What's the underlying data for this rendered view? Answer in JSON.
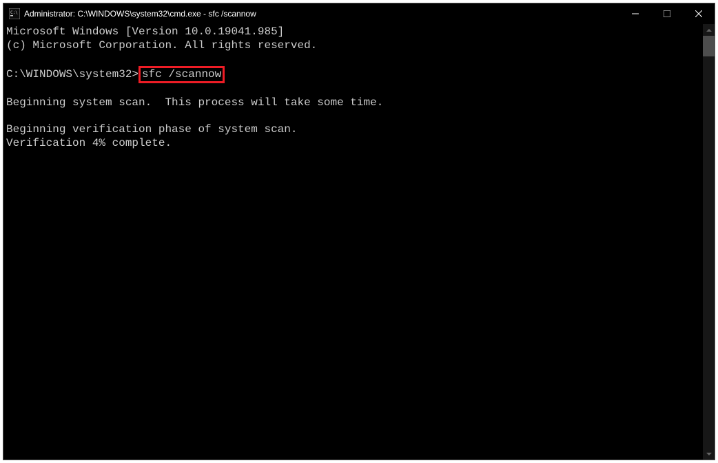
{
  "titlebar": {
    "title": "Administrator: C:\\WINDOWS\\system32\\cmd.exe - sfc  /scannow"
  },
  "terminal": {
    "line1": "Microsoft Windows [Version 10.0.19041.985]",
    "line2": "(c) Microsoft Corporation. All rights reserved.",
    "blank1": "",
    "prompt": "C:\\WINDOWS\\system32>",
    "command": "sfc /scannow",
    "blank2": "",
    "line5": "Beginning system scan.  This process will take some time.",
    "blank3": "",
    "line7": "Beginning verification phase of system scan.",
    "line8": "Verification 4% complete."
  }
}
